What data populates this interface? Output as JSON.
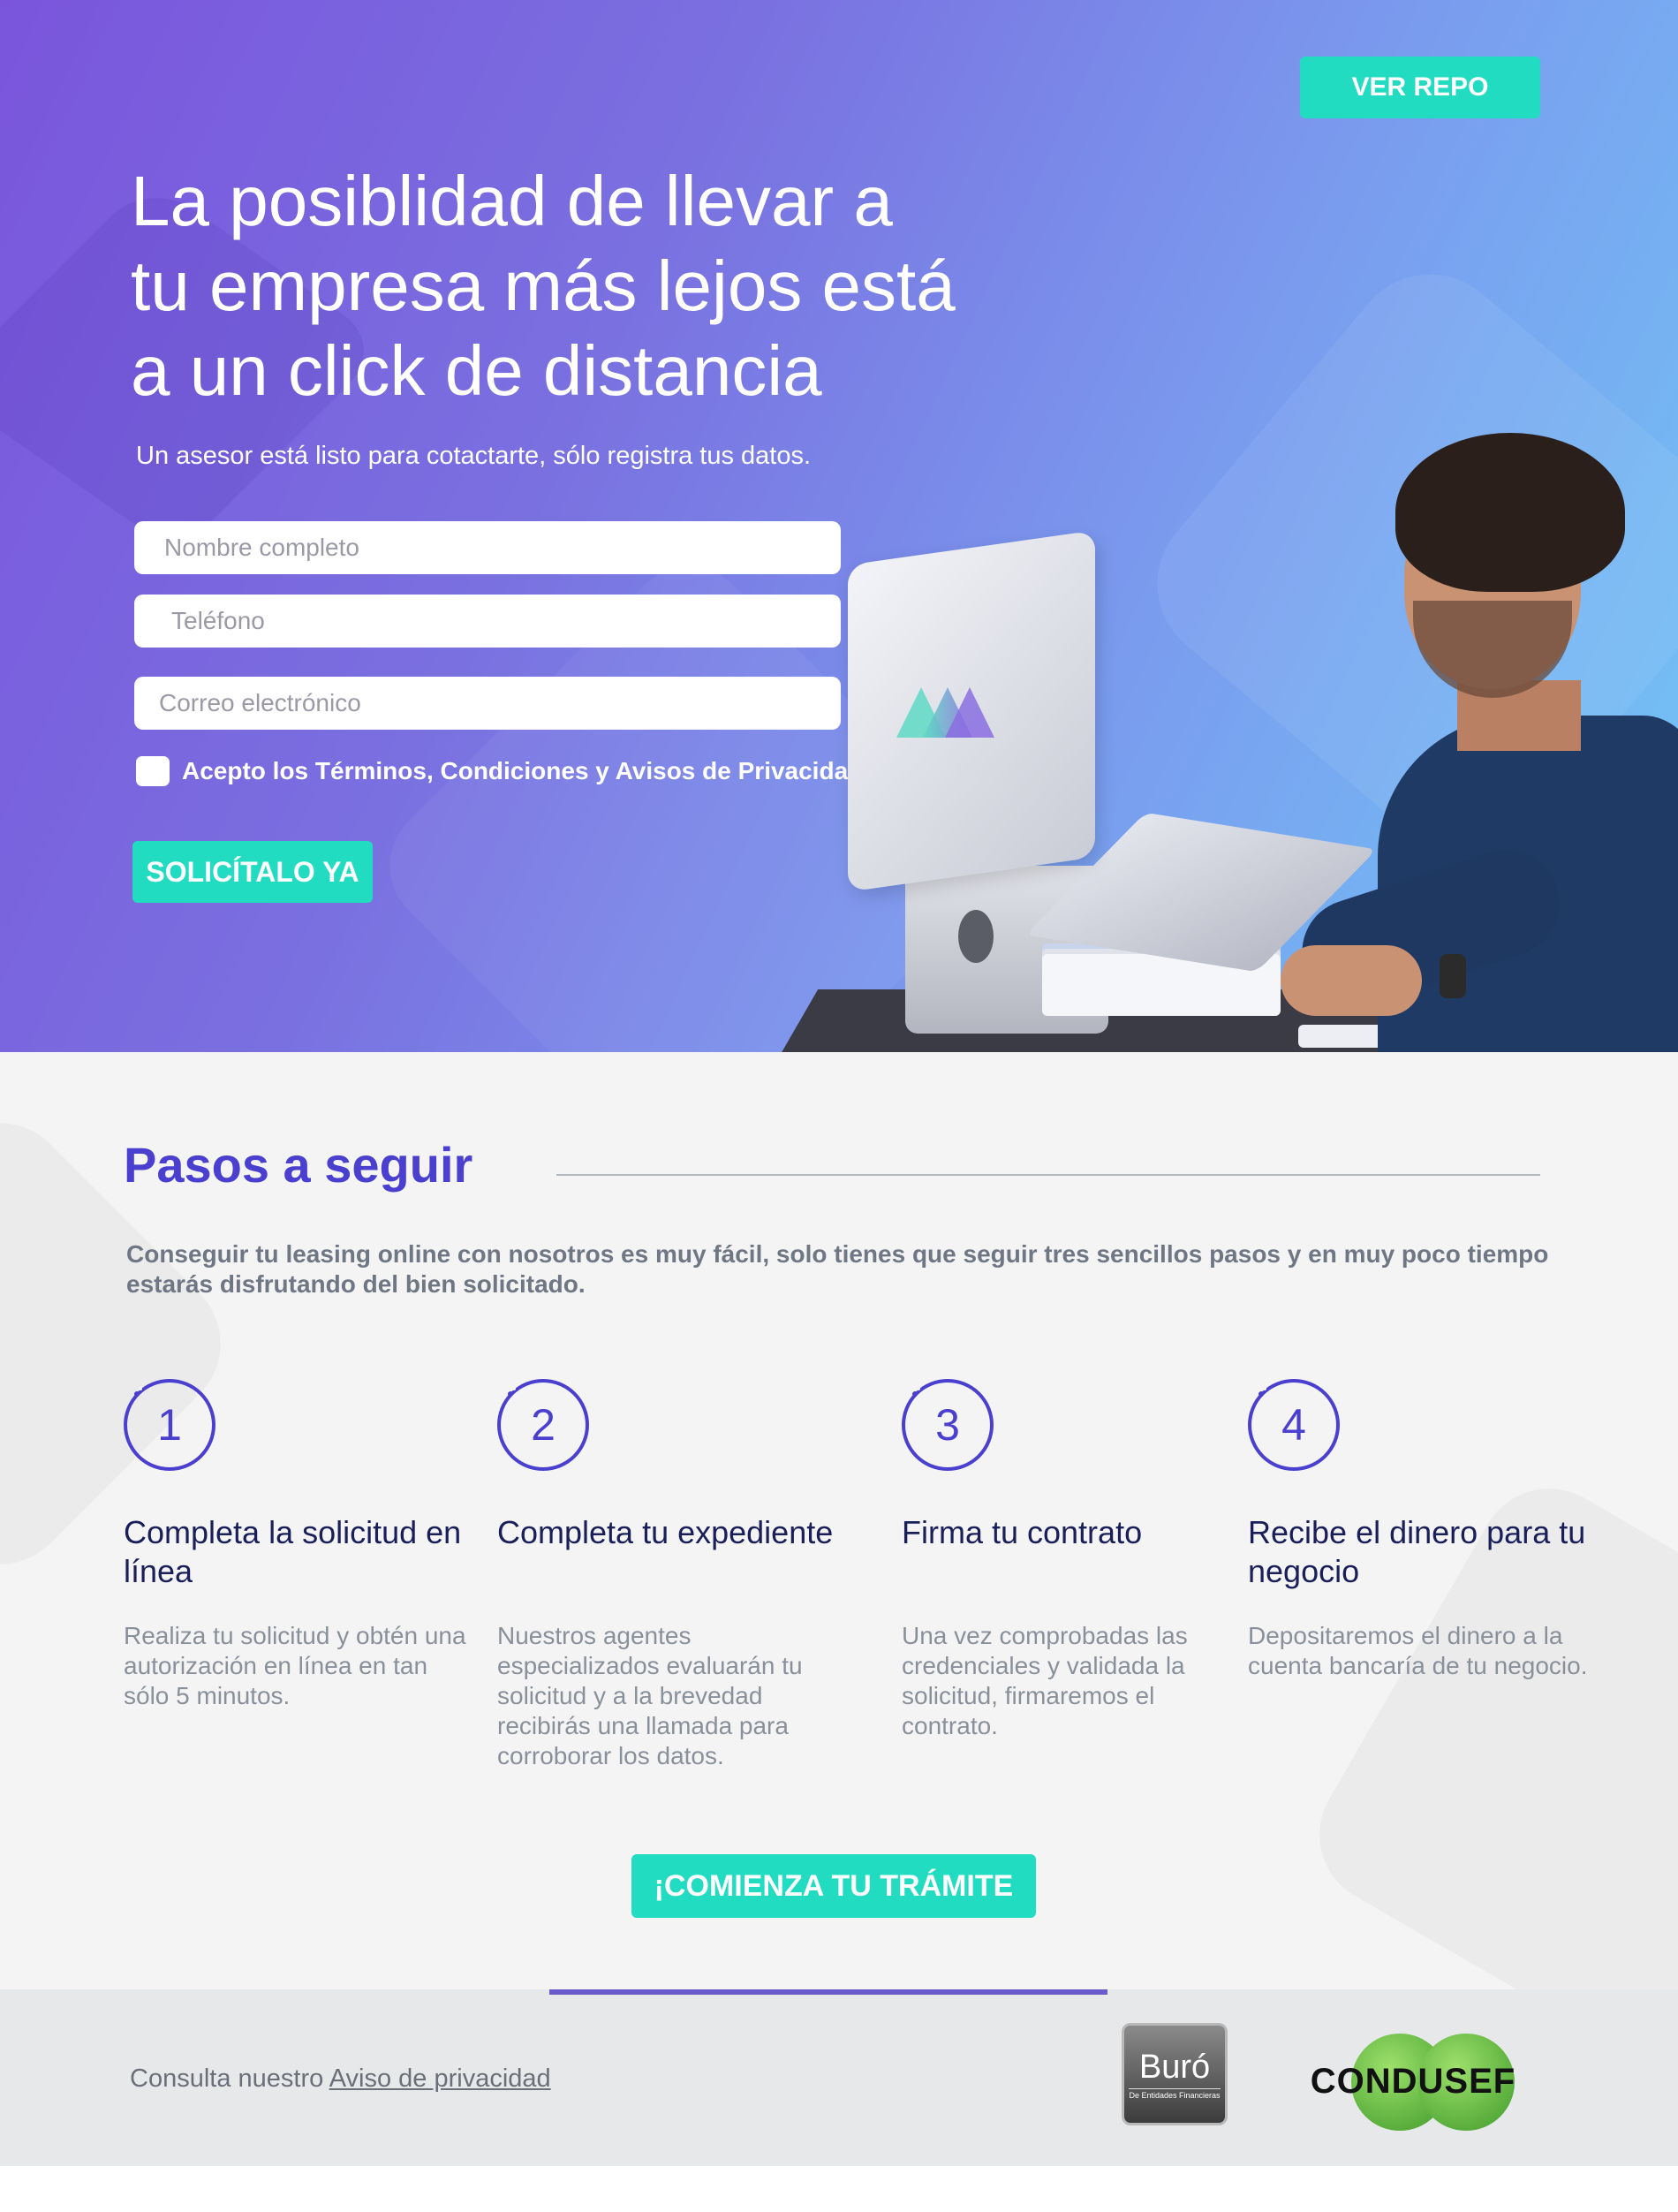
{
  "hero": {
    "repo_button": "VER REPO",
    "headline_1": "La posiblidad de llevar a",
    "headline_2": "tu empresa más lejos está",
    "headline_3": "a un click de distancia",
    "subline": "Un asesor está listo para cotactarte, sólo registra tus datos.",
    "form": {
      "name_placeholder": "Nombre completo",
      "phone_placeholder": "Teléfono",
      "email_placeholder": "Correo electrónico",
      "terms_label": "Acepto los Términos, Condiciones y Avisos de Privacidad",
      "submit_label": "SOLICÍTALO YA"
    }
  },
  "steps": {
    "title": "Pasos a seguir",
    "intro": "Conseguir tu leasing online con nosotros es muy fácil, solo tienes que seguir tres sencillos pasos y en muy poco tiempo estarás disfrutando del bien solicitado.",
    "items": [
      {
        "number": "1",
        "title": "Completa la solicitud en línea",
        "body": "Realiza tu solicitud y obtén una autorización en línea en tan sólo 5 minutos."
      },
      {
        "number": "2",
        "title": "Completa tu expediente",
        "body": "Nuestros agentes especializados evaluarán tu solicitud y a la brevedad recibirás una llamada para corroborar los datos."
      },
      {
        "number": "3",
        "title": "Firma tu contrato",
        "body": "Una vez comprobadas las credenciales y validada la solicitud, firmaremos el contrato."
      },
      {
        "number": "4",
        "title": "Recibe el dinero para tu negocio",
        "body": "Depositaremos el dinero a la cuenta bancaría de tu negocio."
      }
    ],
    "cta_label": "¡COMIENZA TU TRÁMITE"
  },
  "footer": {
    "privacy_prefix": "Consulta nuestro ",
    "privacy_link": "Aviso de privacidad",
    "buro_main": "Buró",
    "buro_sub": "De Entidades Financieras",
    "condusef": "CONDUSEF"
  },
  "colors": {
    "accent": "#22dcc2",
    "primary": "#4a3fce",
    "hero_gradient_start": "#7a55dc",
    "hero_gradient_end": "#72c6f6"
  }
}
